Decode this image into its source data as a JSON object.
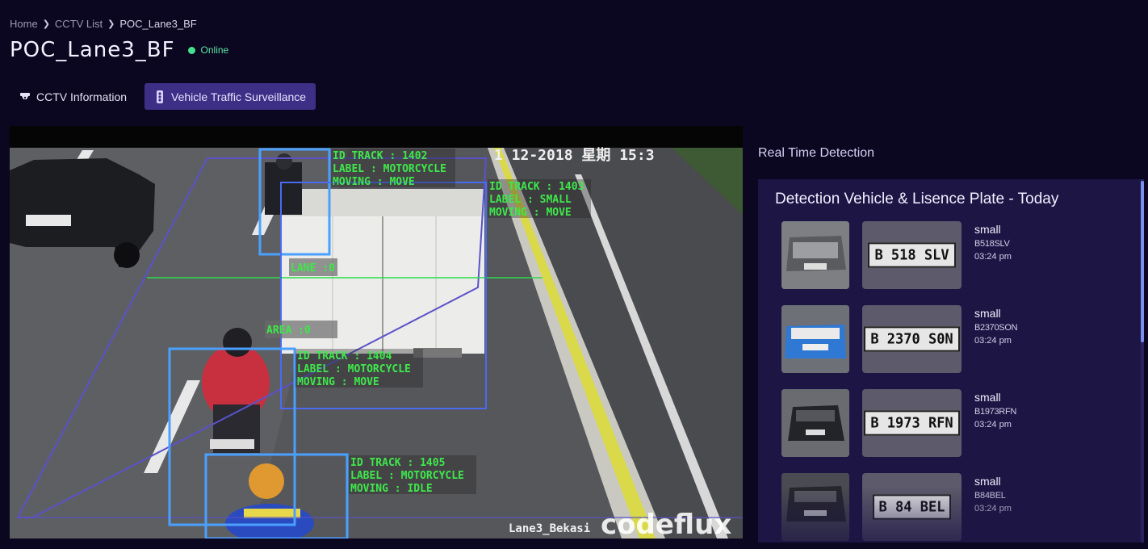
{
  "breadcrumb": {
    "items": [
      "Home",
      "CCTV List",
      "POC_Lane3_BF"
    ]
  },
  "page": {
    "title": "POC_Lane3_BF",
    "status": "Online",
    "status_color": "#45e08e"
  },
  "tabs": [
    {
      "label": "CCTV Information",
      "icon": "cctv-camera-icon",
      "active": false
    },
    {
      "label": "Vehicle Traffic Surveillance",
      "icon": "traffic-light-icon",
      "active": true
    }
  ],
  "video": {
    "timestamp": "1 12-2018 星期  15:3",
    "watermark": "codeflux",
    "lane_caption": "Lane3_Bekasi",
    "lane_label": "LANE :0",
    "area_label": "AREA :0",
    "tracks": [
      {
        "id": "ID TRACK : 1402",
        "label": "LABEL : MOTORCYCLE",
        "moving": "MOVING : MOVE"
      },
      {
        "id": "ID TRACK : 1403",
        "label": "LABEL : SMALL",
        "moving": "MOVING : MOVE"
      },
      {
        "id": "ID TRACK : 1404",
        "label": "LABEL : MOTORCYCLE",
        "moving": "MOVING : MOVE"
      },
      {
        "id": "ID TRACK : 1405",
        "label": "LABEL : MOTORCYCLE",
        "moving": "MOVING : IDLE"
      }
    ]
  },
  "realtime": {
    "title": "Real Time Detection",
    "panel_heading": "Detection Vehicle & Lisence Plate - Today",
    "detections": [
      {
        "class": "small",
        "plate": "B518SLV",
        "plate_image_text": "B  518  SLV",
        "time": "03:24 pm",
        "car_color": "#8a8a8a"
      },
      {
        "class": "small",
        "plate": "B2370SON",
        "plate_image_text": "B  2370  S0N",
        "time": "03:24 pm",
        "car_color": "#3a7fd0"
      },
      {
        "class": "small",
        "plate": "B1973RFN",
        "plate_image_text": "B  1973  RFN",
        "time": "03:24 pm",
        "car_color": "#2a2a2e"
      },
      {
        "class": "small",
        "plate": "B84BEL",
        "plate_image_text": "B   84   BEL",
        "time": "03:24 pm",
        "car_color": "#3b3b40"
      }
    ]
  }
}
